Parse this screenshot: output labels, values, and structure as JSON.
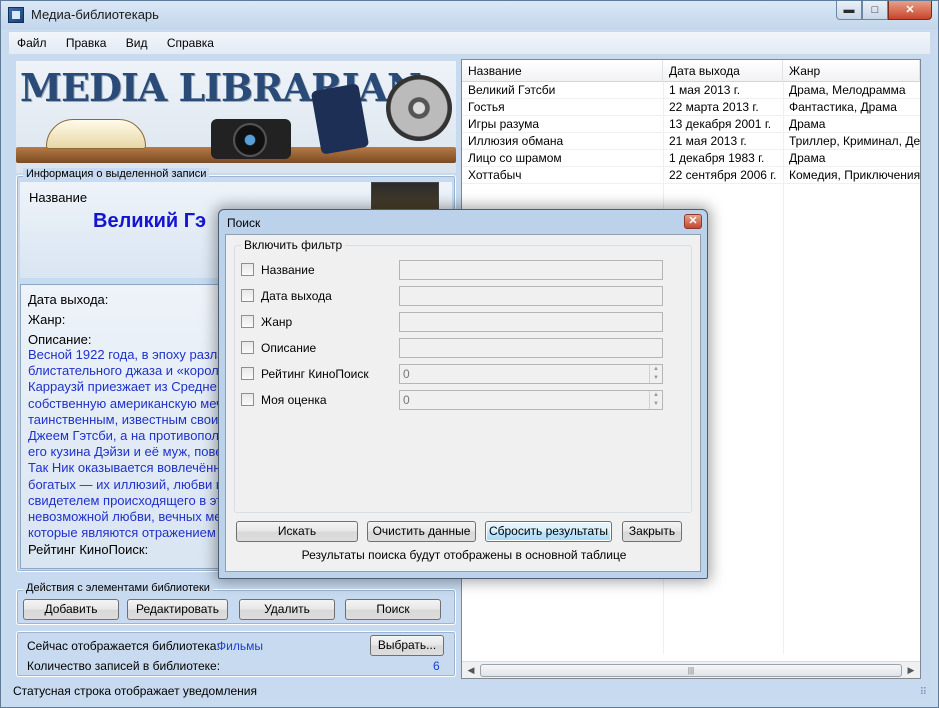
{
  "window": {
    "title": "Медиа-библиотекарь",
    "controls": {
      "minimize": "▬",
      "maximize": "□",
      "close": "✕"
    }
  },
  "menu": [
    "Файл",
    "Правка",
    "Вид",
    "Справка"
  ],
  "banner": {
    "title": "MEDIA LIBRARIAN"
  },
  "info": {
    "group_label": "Информация о выделенной записи",
    "name_label": "Название",
    "movie_title": "Великий Гэ",
    "release_label": "Дата выхода:",
    "genre_label": "Жанр:",
    "description_label": "Описание:",
    "description_lines": [
      "Весной 1922 года, в эпоху разла",
      "блистательного джаза и «короле",
      "Карраузй приезжает из Средне",
      "собственную американскую меч",
      "таинственным, известным свои",
      "Джеем Гэтсби, а на противопол",
      "его кузина Дэйзи и её муж, пове",
      "Так Ник оказывается вовлечённ",
      "богатых — их иллюзий, любви и",
      "свидетелем происходящего в эт",
      "невозможной любви, вечных ме",
      "которые являются отражением"
    ],
    "rating_label": "Рейтинг КиноПоиск:"
  },
  "actions": {
    "group_label": "Действия с элементами библиотеки",
    "add": "Добавить",
    "edit": "Редактировать",
    "delete": "Удалить",
    "search": "Поиск"
  },
  "library": {
    "current_label": "Сейчас отображается библиотека:",
    "current_value": "Фильмы",
    "choose_button": "Выбрать...",
    "count_label": "Количество записей в библиотеке:",
    "count_value": "6"
  },
  "table": {
    "columns": [
      "Название",
      "Дата выхода",
      "Жанр"
    ],
    "rows": [
      [
        "Великий Гэтсби",
        "1 мая 2013 г.",
        "Драма, Мелодрамма"
      ],
      [
        "Гостья",
        "22 марта 2013 г.",
        "Фантастика, Драма"
      ],
      [
        "Игры разума",
        "13 декабря 2001 г.",
        "Драма"
      ],
      [
        "Иллюзия обмана",
        "21 мая 2013 г.",
        "Триллер, Криминал, Детек"
      ],
      [
        "Лицо со шрамом",
        "1 декабря 1983 г.",
        "Драма"
      ],
      [
        "Хоттабыч",
        "22 сентября 2006 г.",
        "Комедия, Приключения"
      ]
    ],
    "scroll": {
      "left": "◀",
      "right": "▶",
      "thumb": "|||"
    }
  },
  "status": {
    "text": "Статусная строка отображает уведомления",
    "grip": "⠿"
  },
  "search_dialog": {
    "title": "Поиск",
    "close": "✕",
    "filter_legend": "Включить фильтр",
    "filters": [
      {
        "label": "Название",
        "value": ""
      },
      {
        "label": "Дата выхода",
        "value": ""
      },
      {
        "label": "Жанр",
        "value": ""
      },
      {
        "label": "Описание",
        "value": ""
      },
      {
        "label": "Рейтинг КиноПоиск",
        "value": "0"
      },
      {
        "label": "Моя оценка",
        "value": "0"
      }
    ],
    "spin": {
      "up": "▲",
      "down": "▼"
    },
    "buttons": {
      "search": "Искать",
      "clear": "Очистить данные",
      "reset": "Сбросить результаты",
      "close": "Закрыть"
    },
    "note": "Результаты поиска будут отображены в основной таблице"
  }
}
